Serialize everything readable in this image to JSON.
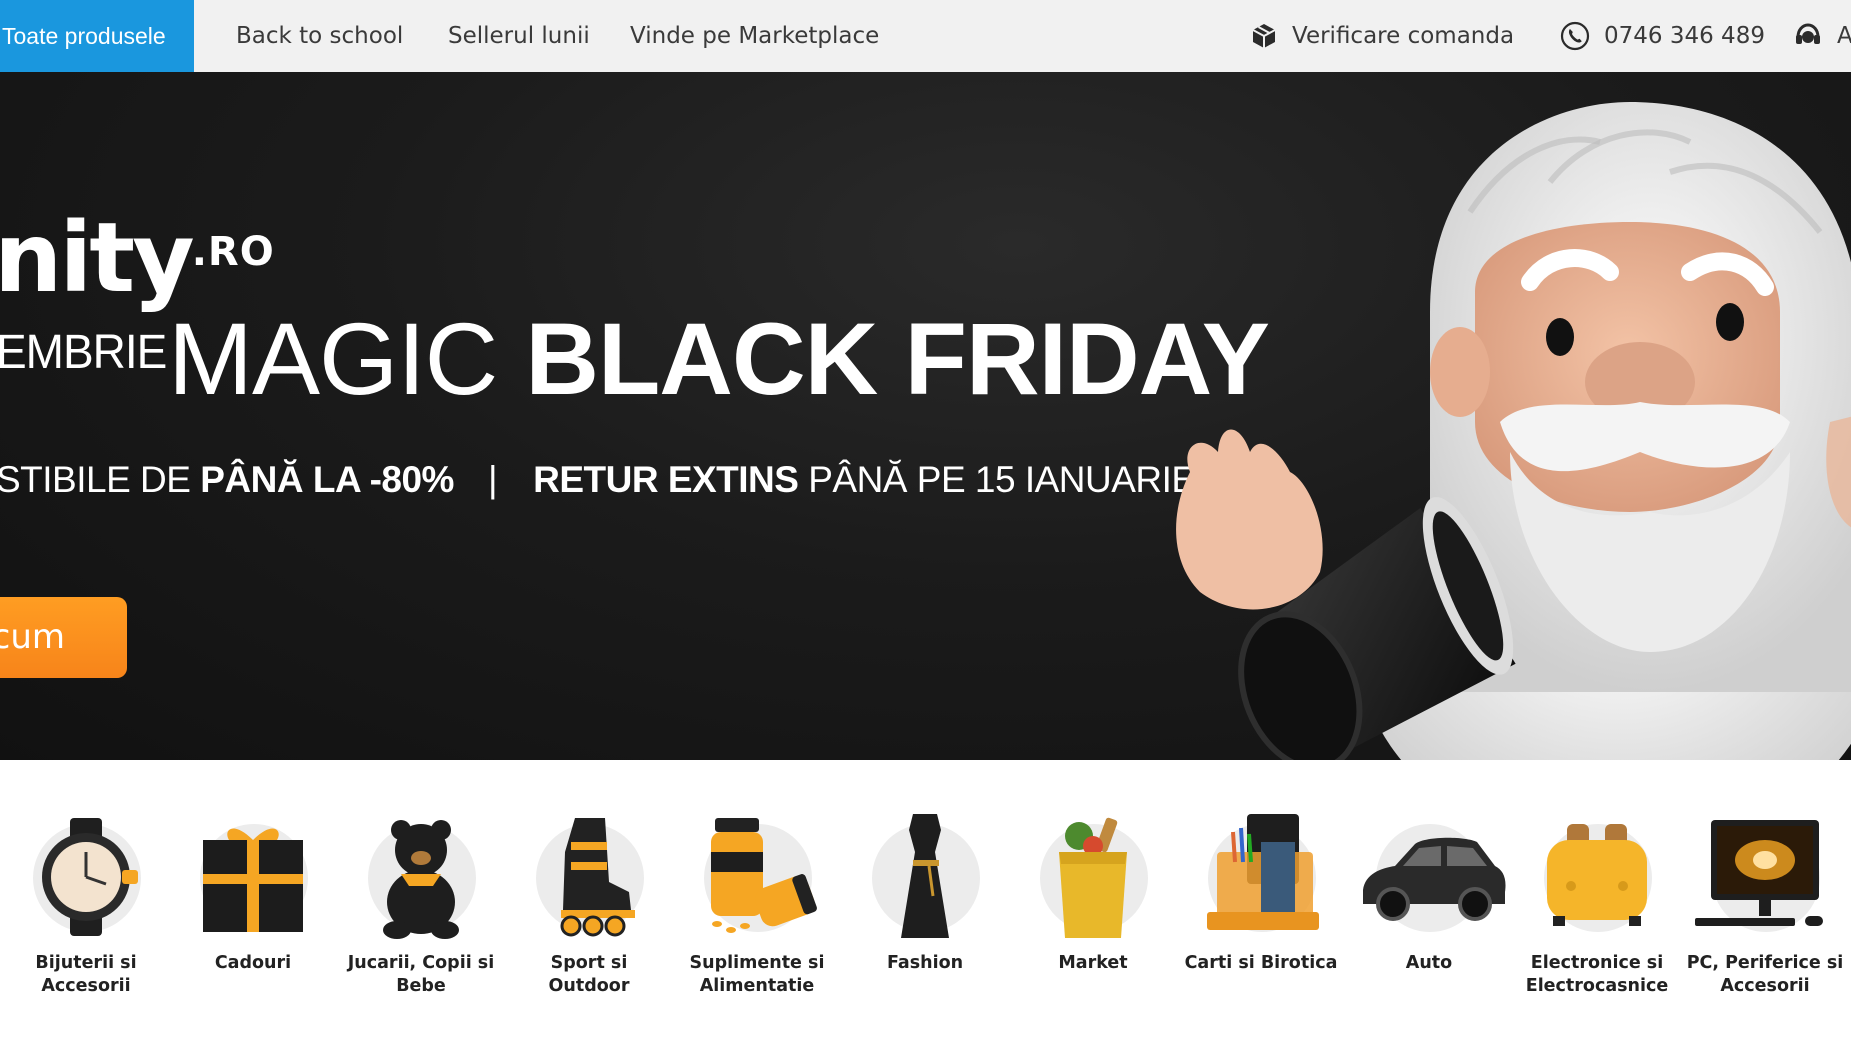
{
  "nav": {
    "all_products": "Toate produsele",
    "links": [
      "Back to school",
      "Sellerul lunii",
      "Vinde pe Marketplace"
    ],
    "order_check": {
      "icon": "package-icon",
      "label": "Verificare comanda"
    },
    "phone": {
      "icon": "phone-icon",
      "label": "0746 346 489"
    },
    "support": {
      "icon": "support-headset-icon",
      "label": "A"
    }
  },
  "hero": {
    "brand_main": "nity",
    "brand_suffix": ".RO",
    "month_fragment": "EMBRIE",
    "headline_thin": "MAGIC",
    "headline_bold": "BLACK FRIDAY",
    "sub_prefix": "STIBILE DE ",
    "sub_bold_1": "PÂNĂ LA -80%",
    "sub_separator": "|",
    "sub_bold_2": "RETUR EXTINS",
    "sub_suffix": " PÂNĂ PE 15 IANUARIE",
    "cta_label": "cum",
    "colors": {
      "background": "#1b1b1b",
      "cta": "#f7841a",
      "text": "#ffffff"
    }
  },
  "categories": [
    {
      "label_1": "Bijuterii si",
      "label_2": "Accesorii",
      "icon": "watch-icon"
    },
    {
      "label_1": "Cadouri",
      "label_2": "",
      "icon": "gift-box-icon"
    },
    {
      "label_1": "Jucarii, Copii si",
      "label_2": "Bebe",
      "icon": "teddy-bear-icon"
    },
    {
      "label_1": "Sport si",
      "label_2": "Outdoor",
      "icon": "roller-skate-icon"
    },
    {
      "label_1": "Suplimente si",
      "label_2": "Alimentatie",
      "icon": "supplement-jar-icon"
    },
    {
      "label_1": "Fashion",
      "label_2": "",
      "icon": "dress-icon"
    },
    {
      "label_1": "Market",
      "label_2": "",
      "icon": "grocery-bag-icon"
    },
    {
      "label_1": "Carti si Birotica",
      "label_2": "",
      "icon": "desk-organizer-icon"
    },
    {
      "label_1": "Auto",
      "label_2": "",
      "icon": "car-icon"
    },
    {
      "label_1": "Electronice si",
      "label_2": "Electrocasnice",
      "icon": "toaster-icon"
    },
    {
      "label_1": "PC, Periferice si",
      "label_2": "Accesorii",
      "icon": "desktop-computer-icon"
    }
  ]
}
